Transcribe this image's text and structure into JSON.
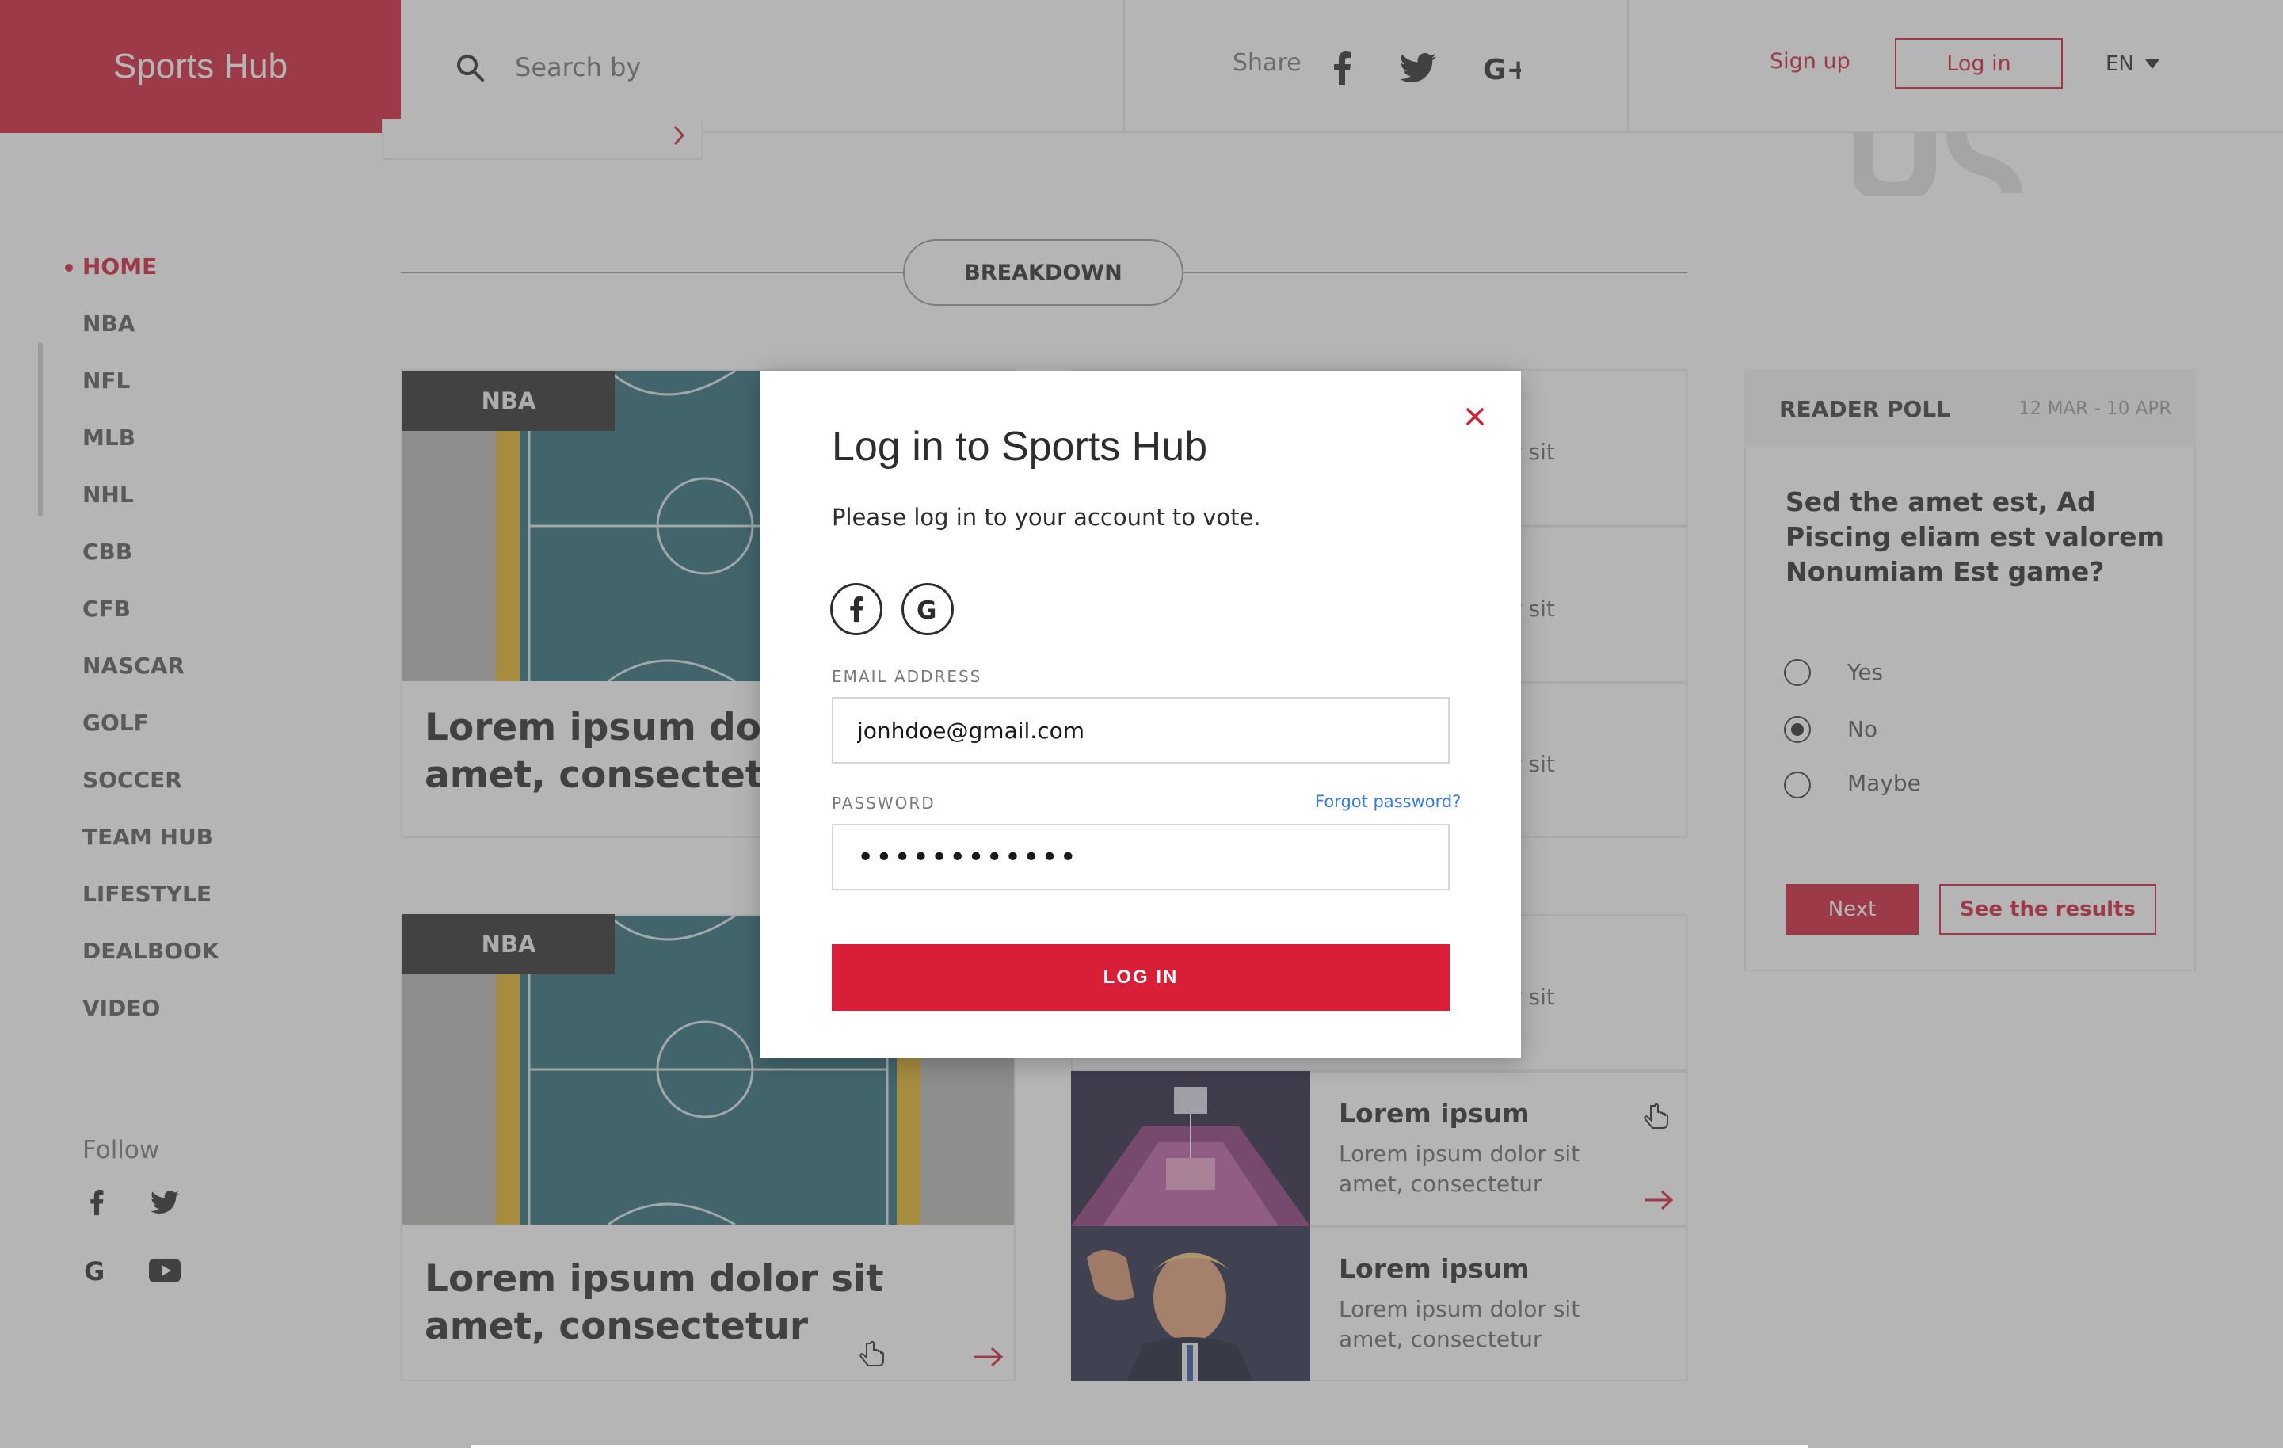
{
  "header": {
    "brand": "Sports Hub",
    "search_placeholder": "Search by",
    "share_label": "Share",
    "share_icons": [
      "facebook-icon",
      "twitter-icon",
      "google-plus-icon"
    ],
    "signup_label": "Sign up",
    "login_label": "Log in",
    "language": "EN"
  },
  "sidebar": {
    "items": [
      {
        "label": "HOME",
        "active": true
      },
      {
        "label": "NBA"
      },
      {
        "label": "NFL"
      },
      {
        "label": "MLB"
      },
      {
        "label": "NHL"
      },
      {
        "label": "CBB"
      },
      {
        "label": "CFB"
      },
      {
        "label": "NASCAR"
      },
      {
        "label": "GOLF"
      },
      {
        "label": "SOCCER"
      },
      {
        "label": "TEAM HUB"
      },
      {
        "label": "LIFESTYLE"
      },
      {
        "label": "DEALBOOK"
      },
      {
        "label": "VIDEO"
      }
    ],
    "follow_label": "Follow",
    "follow_icons": [
      "facebook-icon",
      "twitter-icon",
      "google-icon",
      "youtube-icon"
    ]
  },
  "main": {
    "section_label": "BREAKDOWN",
    "feature_cards": [
      {
        "tag": "NBA",
        "title_line1": "Lorem ipsum dolor",
        "title_line2": "amet, consectetur"
      },
      {
        "tag": "NBA",
        "title_line1": "Lorem ipsum dolor sit",
        "title_line2": "amet, consectetur"
      }
    ],
    "list_partial_text": [
      "or sit",
      "or sit",
      "or sit",
      "or sit"
    ],
    "list_items": [
      {
        "title": "Lorem ipsum",
        "text_line1": "Lorem ipsum dolor sit",
        "text_line2": "amet, consectetur"
      },
      {
        "title": "Lorem ipsum",
        "text_line1": "Lorem ipsum dolor sit",
        "text_line2": "amet, consectetur"
      }
    ]
  },
  "poll": {
    "title": "READER POLL",
    "date_range": "12 MAR - 10 APR",
    "question": "Sed the amet est, Ad Piscing eliam est valorem Nonumiam Est game?",
    "options": [
      {
        "label": "Yes",
        "selected": false
      },
      {
        "label": "No",
        "selected": true
      },
      {
        "label": "Maybe",
        "selected": false
      }
    ],
    "next_label": "Next",
    "results_label": "See the results"
  },
  "modal": {
    "title": "Log in to Sports Hub",
    "subtitle": "Please log in to your account to vote.",
    "social_icons": [
      "facebook-icon",
      "google-icon"
    ],
    "email_label": "EMAIL ADDRESS",
    "email_value": "jonhdoe@gmail.com",
    "password_label": "PASSWORD",
    "password_value": "••••••••••••",
    "forgot_label": "Forgot password?",
    "submit_label": "LOG IN"
  },
  "colors": {
    "brand": "#d31f37",
    "link": "#3a7bd5",
    "dark_tag": "#2f2f2f"
  }
}
